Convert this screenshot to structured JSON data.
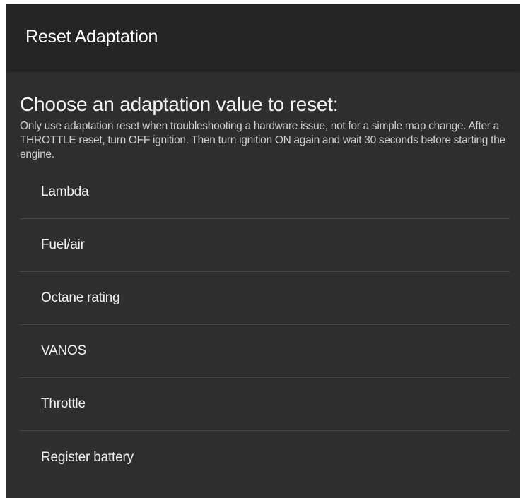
{
  "app_bar": {
    "title": "Reset Adaptation"
  },
  "main": {
    "heading": "Choose an adaptation value to reset:",
    "description": "Only use adaptation reset when troubleshooting a hardware issue, not for a simple map change. After a THROTTLE reset, turn OFF ignition. Then turn ignition ON again and wait 30 seconds before starting the engine.",
    "options": [
      {
        "label": "Lambda"
      },
      {
        "label": "Fuel/air"
      },
      {
        "label": "Octane rating"
      },
      {
        "label": "VANOS"
      },
      {
        "label": "Throttle"
      },
      {
        "label": "Register battery"
      }
    ]
  },
  "colors": {
    "background": "#2e2e2e",
    "app_bar": "#252525",
    "divider": "#454545",
    "text_primary": "#ffffff",
    "text_secondary": "#cfcfcf"
  }
}
